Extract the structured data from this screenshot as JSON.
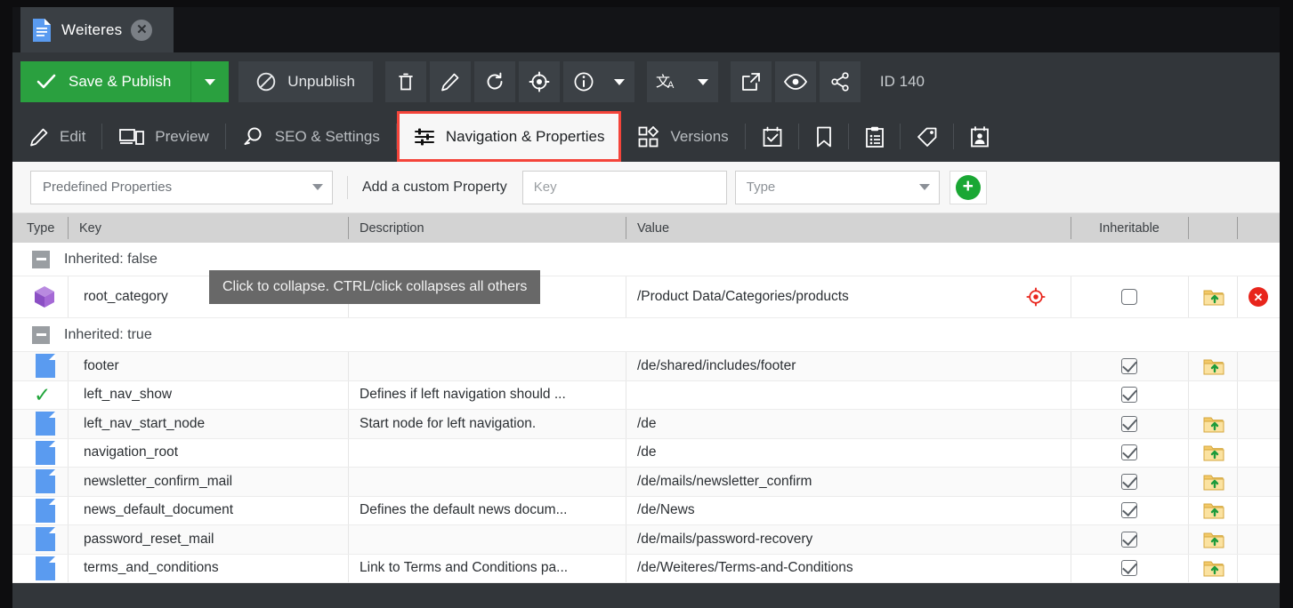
{
  "window": {
    "tab_title": "Weiteres",
    "tab_icon": "document-icon",
    "close_icon": "close-icon"
  },
  "toolbar": {
    "save_publish_label": "Save & Publish",
    "save_publish_icon": "check-icon",
    "save_publish_caret_icon": "chevron-down-icon",
    "unpublish_label": "Unpublish",
    "unpublish_icon": "no-entry-icon",
    "id_label": "ID 140",
    "icon_buttons": [
      {
        "name": "delete-icon",
        "title": "Delete"
      },
      {
        "name": "rename-pencil-icon",
        "title": "Rename"
      },
      {
        "name": "reload-icon",
        "title": "Reload"
      },
      {
        "name": "locate-target-icon",
        "title": "Locate in tree"
      },
      {
        "name": "info-icon",
        "title": "Info"
      },
      {
        "name": "chevron-down-icon",
        "title": "More"
      },
      {
        "name": "translate-icon",
        "title": "Translate"
      },
      {
        "name": "chevron-down-icon",
        "title": "Translate options"
      },
      {
        "name": "open-external-icon",
        "title": "Open in new window"
      },
      {
        "name": "preview-eye-icon",
        "title": "Preview"
      },
      {
        "name": "share-icon",
        "title": "Share"
      }
    ]
  },
  "tabs": [
    {
      "label": "Edit",
      "icon": "pencil-icon",
      "active": false
    },
    {
      "label": "Preview",
      "icon": "devices-icon",
      "active": false
    },
    {
      "label": "SEO & Settings",
      "icon": "seo-search-icon",
      "active": false
    },
    {
      "label": "Navigation & Properties",
      "icon": "sliders-icon",
      "active": true
    },
    {
      "label": "Versions",
      "icon": "versions-blocks-icon",
      "active": false
    },
    {
      "label": "",
      "icon": "calendar-check-icon",
      "active": false
    },
    {
      "label": "",
      "icon": "bookmark-icon",
      "active": false
    },
    {
      "label": "",
      "icon": "clipboard-list-icon",
      "active": false
    },
    {
      "label": "",
      "icon": "tag-icon",
      "active": false
    },
    {
      "label": "",
      "icon": "contact-card-icon",
      "active": false
    }
  ],
  "propbar": {
    "predefined_select_value": "Predefined Properties",
    "predefined_select_caret": "chevron-down-icon",
    "add_custom_label": "Add a custom Property",
    "key_placeholder": "Key",
    "key_value": "",
    "type_select_value": "Type",
    "type_select_caret": "chevron-down-icon",
    "add_button_icon": "plus-icon"
  },
  "grid": {
    "columns": [
      "Type",
      "Key",
      "Description",
      "Value",
      "Inheritable",
      "",
      ""
    ],
    "groups": [
      {
        "label": "Inherited: false",
        "collapse_icon": "collapse-minus-icon"
      },
      {
        "label": "Inherited: true",
        "collapse_icon": "collapse-minus-icon"
      }
    ],
    "rows_group1": [
      {
        "type_icon": "cube-icon",
        "key": "root_category",
        "description": "",
        "value": "/Product Data/Categories/products",
        "value_action_icon": "locate-target-icon",
        "inheritable": false,
        "has_folder_action": true,
        "folder_icon": "folder-upload-icon",
        "has_delete_action": true,
        "delete_icon": "delete-circle-icon"
      }
    ],
    "rows_group2": [
      {
        "type_icon": "document-icon",
        "key": "footer",
        "description": "",
        "value": "/de/shared/includes/footer",
        "inheritable": true,
        "has_folder_action": true,
        "folder_icon": "folder-upload-icon"
      },
      {
        "type_icon": "check-icon",
        "key": "left_nav_show",
        "description": "Defines if left navigation should ...",
        "value": "",
        "inheritable": true,
        "has_folder_action": false,
        "folder_icon": ""
      },
      {
        "type_icon": "document-icon",
        "key": "left_nav_start_node",
        "description": "Start node for left navigation.",
        "value": "/de",
        "inheritable": true,
        "has_folder_action": true,
        "folder_icon": "folder-upload-icon"
      },
      {
        "type_icon": "document-icon",
        "key": "navigation_root",
        "description": "",
        "value": "/de",
        "inheritable": true,
        "has_folder_action": true,
        "folder_icon": "folder-upload-icon"
      },
      {
        "type_icon": "document-icon",
        "key": "newsletter_confirm_mail",
        "description": "",
        "value": "/de/mails/newsletter_confirm",
        "inheritable": true,
        "has_folder_action": true,
        "folder_icon": "folder-upload-icon"
      },
      {
        "type_icon": "document-icon",
        "key": "news_default_document",
        "description": "Defines the default news docum...",
        "value": "/de/News",
        "inheritable": true,
        "has_folder_action": true,
        "folder_icon": "folder-upload-icon"
      },
      {
        "type_icon": "document-icon",
        "key": "password_reset_mail",
        "description": "",
        "value": "/de/mails/password-recovery",
        "inheritable": true,
        "has_folder_action": true,
        "folder_icon": "folder-upload-icon"
      },
      {
        "type_icon": "document-icon",
        "key": "terms_and_conditions",
        "description": "Link to Terms and Conditions pa...",
        "value": "/de/Weiteres/Terms-and-Conditions",
        "inheritable": true,
        "has_folder_action": true,
        "folder_icon": "folder-upload-icon"
      }
    ]
  },
  "tooltip": {
    "text": "Click to collapse. CTRL/click collapses all others"
  },
  "colors": {
    "accent_green": "#2aa03f",
    "highlight_red": "#f4443a",
    "chrome_dark": "#32363a",
    "tab_strip": "#131417",
    "doc_blue": "#5a9bf0",
    "cube_purple": "#9b59d0"
  }
}
